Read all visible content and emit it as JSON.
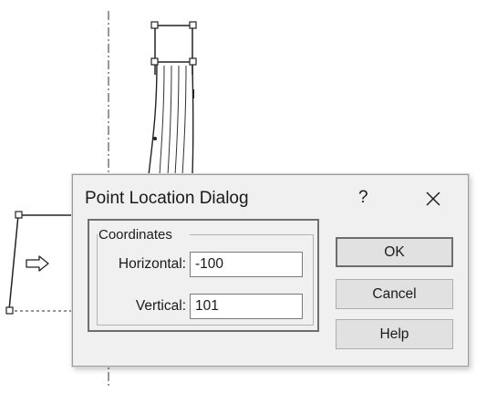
{
  "dialog": {
    "title": "Point Location Dialog",
    "help_glyph": "?",
    "close_icon": "close-icon"
  },
  "coordinates": {
    "group_label": "Coordinates",
    "horizontal": {
      "label": "Horizontal:",
      "value": "-100"
    },
    "vertical": {
      "label": "Vertical:",
      "value": "101"
    }
  },
  "buttons": {
    "ok": "OK",
    "cancel": "Cancel",
    "help": "Help"
  },
  "canvas": {
    "arrow_icon": "right-arrow-icon"
  }
}
